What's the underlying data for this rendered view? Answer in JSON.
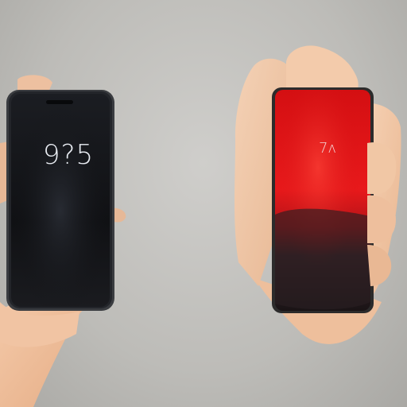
{
  "scene": {
    "background_color": "#c4c3bf",
    "skin_color": "#eec2a0"
  },
  "left_phone": {
    "screen_color": "#121418",
    "frame_color": "#2a2c30",
    "time_text": "9?5",
    "sub_text": "",
    "brand_text": ""
  },
  "right_phone": {
    "screen_color": "#e01818",
    "frame_color": "#2b2a2a",
    "time_text": "7ʌ",
    "brand_text": ""
  }
}
